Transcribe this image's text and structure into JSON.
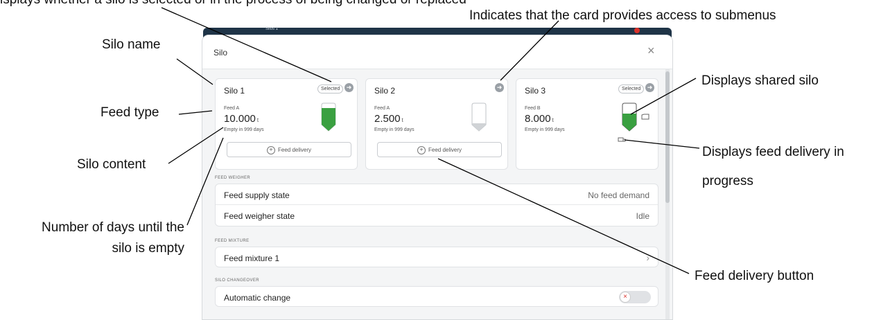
{
  "callouts": {
    "selected_status": "isplays whether a silo is selected or in the process of being changed or replaced",
    "submenus": "Indicates that the card provides access to submenus",
    "silo_name": "Silo name",
    "feed_type": "Feed type",
    "silo_content": "Silo content",
    "days_line1": "Number of days until the",
    "days_line2": "silo is empty",
    "shared_silo": "Displays shared silo",
    "delivery_progress_line1": "Displays feed delivery in",
    "delivery_progress_line2": "progress",
    "delivery_button": "Feed delivery button"
  },
  "app": {
    "header_text": "Silos 1"
  },
  "dialog": {
    "title": "Silo",
    "close_glyph": "×"
  },
  "silos": [
    {
      "name": "Silo 1",
      "badge": "Selected",
      "feed_type": "Feed A",
      "amount": "10.000",
      "unit": "t",
      "empty": "Empty in 999 days",
      "fill_level": 0.85,
      "delivery_label": "Feed delivery"
    },
    {
      "name": "Silo 2",
      "badge": "",
      "feed_type": "Feed A",
      "amount": "2.500",
      "unit": "t",
      "empty": "Empty in 999 days",
      "fill_level": 0.15,
      "delivery_label": "Feed delivery"
    },
    {
      "name": "Silo 3",
      "badge": "Selected",
      "feed_type": "Feed B",
      "amount": "8.000",
      "unit": "t",
      "empty": "Empty in 999 days",
      "fill_level": 0.6,
      "delivery_label": ""
    }
  ],
  "sections": {
    "weigher_label": "FEED WEIGHER",
    "supply_label": "Feed supply state",
    "supply_value": "No feed demand",
    "weigher_state_label": "Feed weigher state",
    "weigher_state_value": "Idle",
    "mixture_label": "FEED MIXTURE",
    "mixture_item": "Feed mixture 1",
    "changeover_label": "SILO CHANGEOVER",
    "auto_change": "Automatic change",
    "toggle_on": false
  },
  "colors": {
    "silo_fill": "#3aa041",
    "header": "#1f3447",
    "notification": "#d9322b"
  },
  "icons": {
    "arrow": "arrow-right-circle-icon",
    "silo": "silo-icon",
    "shared": "shared-silo-icon",
    "truck": "delivery-truck-icon"
  }
}
